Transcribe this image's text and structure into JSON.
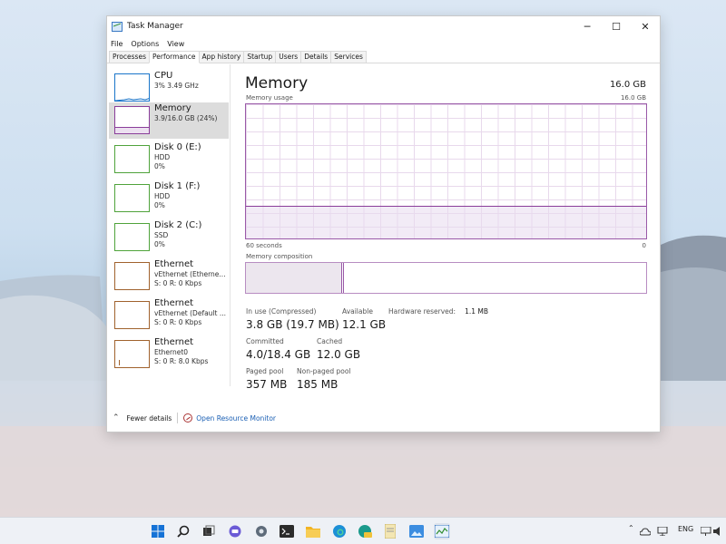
{
  "window": {
    "title": "Task Manager",
    "minimize_glyph": "─",
    "maximize_glyph": "☐",
    "close_glyph": "✕"
  },
  "menu": [
    "File",
    "Options",
    "View"
  ],
  "tabs": [
    "Processes",
    "Performance",
    "App history",
    "Startup",
    "Users",
    "Details",
    "Services"
  ],
  "active_tab": "Performance",
  "sidebar": {
    "items": [
      {
        "name": "CPU",
        "line1": "3% 3.49 GHz",
        "line2": "",
        "color": "#1a75c9"
      },
      {
        "name": "Memory",
        "line1": "3.9/16.0 GB (24%)",
        "line2": "",
        "color": "#8a3d9a"
      },
      {
        "name": "Disk 0 (E:)",
        "line1": "HDD",
        "line2": "0%",
        "color": "#4fa33b"
      },
      {
        "name": "Disk 1 (F:)",
        "line1": "HDD",
        "line2": "0%",
        "color": "#4fa33b"
      },
      {
        "name": "Disk 2 (C:)",
        "line1": "SSD",
        "line2": "0%",
        "color": "#4fa33b"
      },
      {
        "name": "Ethernet",
        "line1": "vEthernet (Etherne...",
        "line2": "S: 0 R: 0 Kbps",
        "color": "#a0622d"
      },
      {
        "name": "Ethernet",
        "line1": "vEthernet (Default ...",
        "line2": "S: 0 R: 0 Kbps",
        "color": "#a0622d"
      },
      {
        "name": "Ethernet",
        "line1": "Ethernet0",
        "line2": "S: 0 R: 8.0 Kbps",
        "color": "#a0622d"
      }
    ]
  },
  "main": {
    "heading": "Memory",
    "total": "16.0 GB",
    "usage_label": "Memory usage",
    "usage_max": "16.0 GB",
    "usage_fraction": 0.24,
    "axis_left": "60 seconds",
    "axis_right": "0",
    "composition_label": "Memory composition",
    "composition_in_use_fraction": 0.24,
    "stats": {
      "in_use_label": "In use (Compressed)",
      "in_use_value": "3.8 GB (19.7 MB)",
      "available_label": "Available",
      "available_value": "12.1 GB",
      "hw_reserved_label": "Hardware reserved:",
      "hw_reserved_value": "1.1 MB",
      "committed_label": "Committed",
      "committed_value": "4.0/18.4 GB",
      "cached_label": "Cached",
      "cached_value": "12.0 GB",
      "paged_label": "Paged pool",
      "paged_value": "357 MB",
      "nonpaged_label": "Non-paged pool",
      "nonpaged_value": "185 MB"
    }
  },
  "footer": {
    "fewer_details": "Fewer details",
    "open_monitor": "Open Resource Monitor"
  },
  "tray": {
    "language": "ENG"
  }
}
